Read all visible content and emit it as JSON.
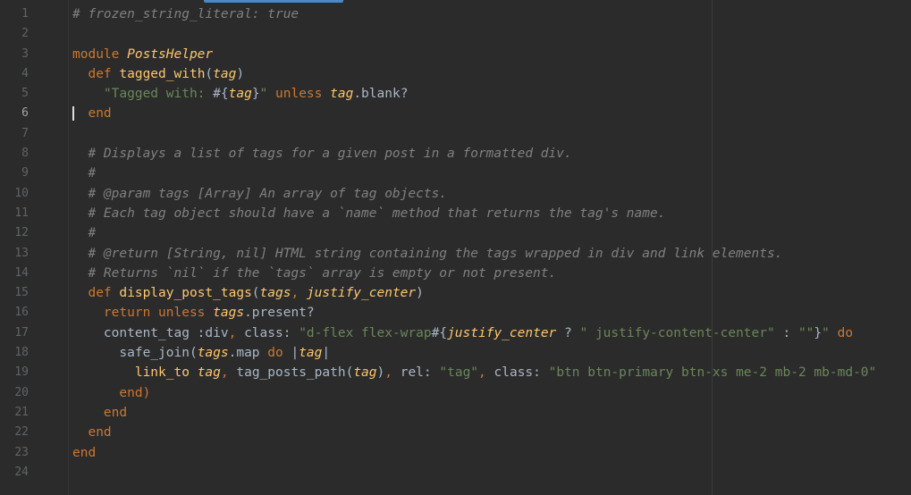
{
  "editor": {
    "current_line": 6,
    "lines": [
      {
        "n": "1",
        "tokens": [
          {
            "t": "# frozen_string_literal: true",
            "c": "cmt"
          }
        ]
      },
      {
        "n": "2",
        "tokens": []
      },
      {
        "n": "3",
        "tokens": [
          {
            "t": "module ",
            "c": "kw"
          },
          {
            "t": "PostsHelper",
            "c": "cls"
          }
        ]
      },
      {
        "n": "4",
        "tokens": [
          {
            "t": "  def ",
            "c": "kw"
          },
          {
            "t": "tagged_with",
            "c": "fn"
          },
          {
            "t": "(",
            "c": "plain"
          },
          {
            "t": "tag",
            "c": "var"
          },
          {
            "t": ")",
            "c": "plain"
          }
        ]
      },
      {
        "n": "5",
        "tokens": [
          {
            "t": "    \"Tagged with: ",
            "c": "str"
          },
          {
            "t": "#{",
            "c": "plain"
          },
          {
            "t": "tag",
            "c": "var"
          },
          {
            "t": "}",
            "c": "plain"
          },
          {
            "t": "\"",
            "c": "str"
          },
          {
            "t": " unless ",
            "c": "kw"
          },
          {
            "t": "tag",
            "c": "var"
          },
          {
            "t": ".blank?",
            "c": "plain"
          }
        ]
      },
      {
        "n": "6",
        "tokens": [
          {
            "t": "  end",
            "c": "kw"
          }
        ]
      },
      {
        "n": "7",
        "tokens": []
      },
      {
        "n": "8",
        "tokens": [
          {
            "t": "  # Displays a list of tags for a given post in a formatted div.",
            "c": "cmt"
          }
        ]
      },
      {
        "n": "9",
        "tokens": [
          {
            "t": "  #",
            "c": "cmt"
          }
        ]
      },
      {
        "n": "10",
        "tokens": [
          {
            "t": "  # @param tags [Array] An array of tag objects.",
            "c": "cmt"
          }
        ]
      },
      {
        "n": "11",
        "tokens": [
          {
            "t": "  # Each tag object should have a `name` method that returns the tag's name.",
            "c": "cmt"
          }
        ]
      },
      {
        "n": "12",
        "tokens": [
          {
            "t": "  #",
            "c": "cmt"
          }
        ]
      },
      {
        "n": "13",
        "tokens": [
          {
            "t": "  # @return [String, nil] HTML string containing the tags wrapped in div and link elements.",
            "c": "cmt"
          }
        ]
      },
      {
        "n": "14",
        "tokens": [
          {
            "t": "  # Returns `nil` if the `tags` array is empty or not present.",
            "c": "cmt"
          }
        ]
      },
      {
        "n": "15",
        "tokens": [
          {
            "t": "  def ",
            "c": "kw"
          },
          {
            "t": "display_post_tags",
            "c": "fn"
          },
          {
            "t": "(",
            "c": "plain"
          },
          {
            "t": "tags",
            "c": "var"
          },
          {
            "t": ", ",
            "c": "kw"
          },
          {
            "t": "justify_center",
            "c": "var"
          },
          {
            "t": ")",
            "c": "plain"
          }
        ]
      },
      {
        "n": "16",
        "tokens": [
          {
            "t": "    return unless ",
            "c": "kw"
          },
          {
            "t": "tags",
            "c": "var"
          },
          {
            "t": ".present?",
            "c": "plain"
          }
        ]
      },
      {
        "n": "17",
        "tokens": [
          {
            "t": "    content_tag :div",
            "c": "plain"
          },
          {
            "t": ", ",
            "c": "kw"
          },
          {
            "t": "class: ",
            "c": "plain"
          },
          {
            "t": "\"d-flex flex-wrap",
            "c": "str"
          },
          {
            "t": "#{",
            "c": "plain"
          },
          {
            "t": "justify_center",
            "c": "var"
          },
          {
            "t": " ? ",
            "c": "plain"
          },
          {
            "t": "\" justify-content-center\"",
            "c": "str"
          },
          {
            "t": " : ",
            "c": "plain"
          },
          {
            "t": "\"\"",
            "c": "str"
          },
          {
            "t": "}",
            "c": "plain"
          },
          {
            "t": "\"",
            "c": "str"
          },
          {
            "t": " do",
            "c": "kw"
          }
        ]
      },
      {
        "n": "18",
        "tokens": [
          {
            "t": "      safe_join(",
            "c": "plain"
          },
          {
            "t": "tags",
            "c": "var"
          },
          {
            "t": ".map ",
            "c": "plain"
          },
          {
            "t": "do ",
            "c": "kw"
          },
          {
            "t": "|",
            "c": "plain"
          },
          {
            "t": "tag",
            "c": "var"
          },
          {
            "t": "|",
            "c": "plain"
          }
        ]
      },
      {
        "n": "19",
        "tokens": [
          {
            "t": "        link_to ",
            "c": "fn"
          },
          {
            "t": "tag",
            "c": "var"
          },
          {
            "t": ", ",
            "c": "kw"
          },
          {
            "t": "tag_posts_path(",
            "c": "plain"
          },
          {
            "t": "tag",
            "c": "var"
          },
          {
            "t": ")",
            "c": "plain"
          },
          {
            "t": ", ",
            "c": "kw"
          },
          {
            "t": "rel: ",
            "c": "plain"
          },
          {
            "t": "\"tag\"",
            "c": "str"
          },
          {
            "t": ", ",
            "c": "kw"
          },
          {
            "t": "class: ",
            "c": "plain"
          },
          {
            "t": "\"btn btn-primary btn-xs me-2 mb-2 mb-md-0\"",
            "c": "str"
          }
        ]
      },
      {
        "n": "20",
        "tokens": [
          {
            "t": "      end)",
            "c": "kw"
          }
        ]
      },
      {
        "n": "21",
        "tokens": [
          {
            "t": "    end",
            "c": "kw"
          }
        ]
      },
      {
        "n": "22",
        "tokens": [
          {
            "t": "  end",
            "c": "kw"
          }
        ]
      },
      {
        "n": "23",
        "tokens": [
          {
            "t": "end",
            "c": "kw"
          }
        ]
      },
      {
        "n": "24",
        "tokens": []
      }
    ]
  }
}
